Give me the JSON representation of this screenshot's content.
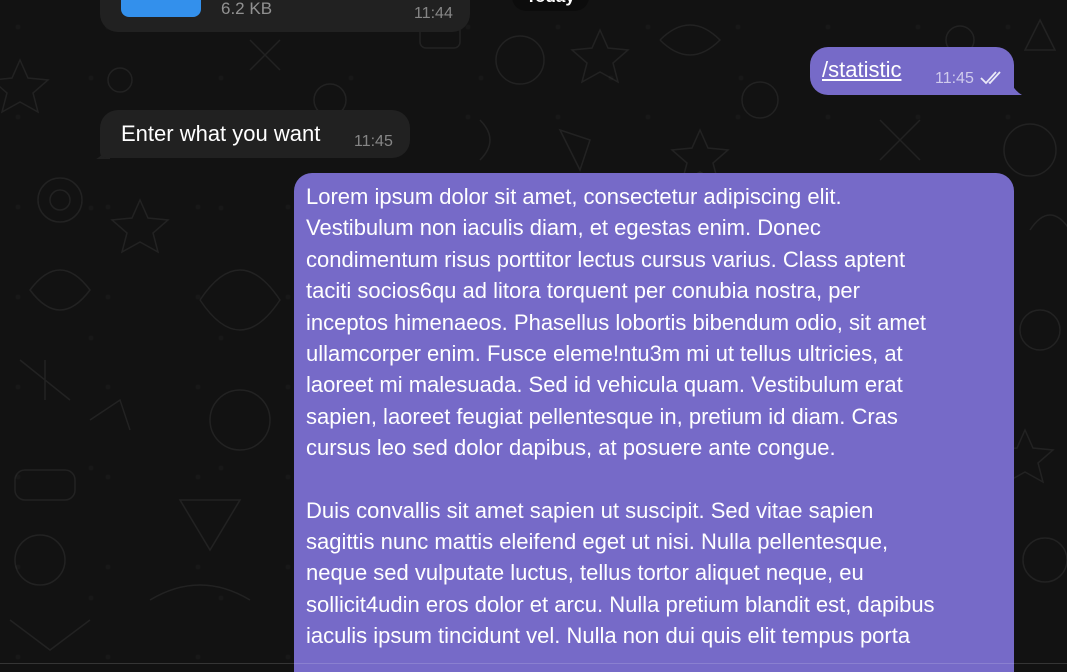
{
  "messages": {
    "file": {
      "size": "6.2 KB",
      "time": "11:44"
    },
    "date_separator": "Today",
    "command": {
      "text": "/statistic",
      "time": "11:45",
      "status": "read"
    },
    "prompt": {
      "text": "Enter what you want",
      "time": "11:45"
    },
    "long": {
      "paragraph1": "Lorem ipsum dolor sit amet, consectetur adipiscing elit.\nVestibulum non iaculis diam, et egestas enim. Donec\ncondimentum risus porttitor lectus cursus varius. Class aptent\ntaciti socios6qu ad litora torquent per conubia nostra, per\ninceptos himenaeos. Phasellus lobortis bibendum odio, sit amet\nullamcorper enim. Fusce eleme!ntu3m mi ut tellus ultricies, at\nlaoreet mi malesuada. Sed id vehicula quam. Vestibulum erat\nsapien, laoreet feugiat pellentesque in, pretium id diam. Cras\ncursus leo sed dolor dapibus, at posuere ante congue.",
      "paragraph2": "Duis convallis sit amet sapien ut suscipit. Sed vitae sapien\nsagittis nunc mattis eleifend eget ut nisi. Nulla pellentesque,\nneque sed vulputate luctus, tellus tortor aliquet neque, eu\nsollicit4udin eros dolor et arcu. Nulla pretium blandit est, dapibus\niaculis ipsum tincidunt vel. Nulla non dui quis elit tempus porta"
    }
  },
  "colors": {
    "background": "#121212",
    "incoming_bubble": "#212121",
    "outgoing_bubble": "#766ac8",
    "file_thumb": "#3390ec"
  }
}
